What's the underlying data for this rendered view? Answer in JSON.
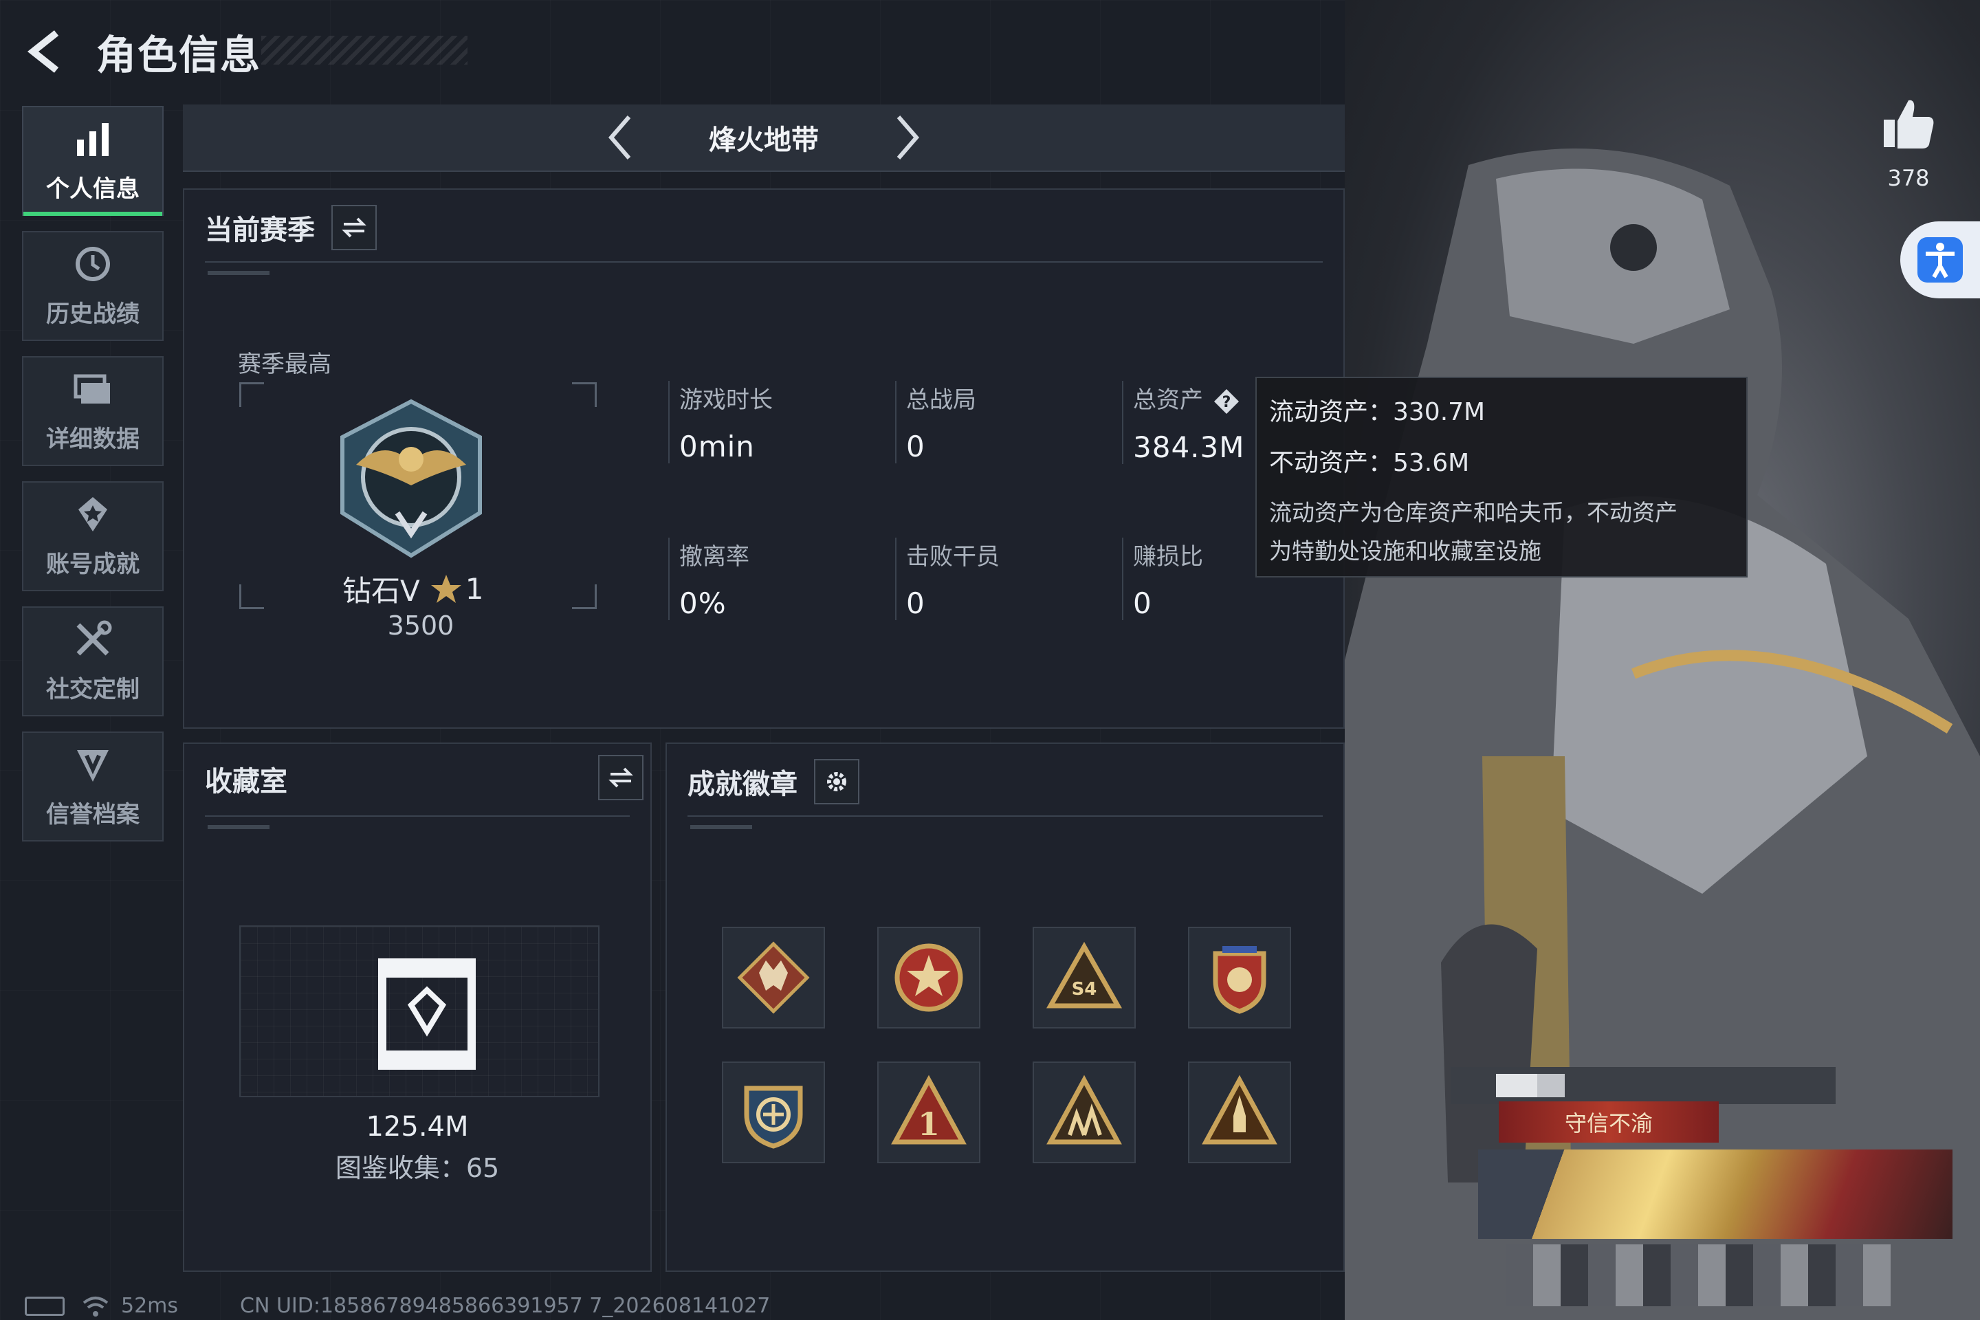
{
  "header": {
    "title": "角色信息"
  },
  "nav": {
    "items": [
      {
        "label": "个人信息",
        "icon": "bar-chart-icon",
        "active": true
      },
      {
        "label": "历史战绩",
        "icon": "history-icon"
      },
      {
        "label": "详细数据",
        "icon": "folder-icon"
      },
      {
        "label": "账号成就",
        "icon": "achievement-icon"
      },
      {
        "label": "社交定制",
        "icon": "tools-icon"
      },
      {
        "label": "信誉档案",
        "icon": "shield-v-icon"
      }
    ]
  },
  "mode": {
    "title": "烽火地带"
  },
  "season": {
    "title": "当前赛季",
    "highest_label": "赛季最高",
    "rank_name": "钻石V",
    "rank_stars": "1",
    "rank_score": "3500",
    "stats": [
      {
        "label": "游戏时长",
        "value": "0min"
      },
      {
        "label": "总战局",
        "value": "0"
      },
      {
        "label": "总资产",
        "value": "384.3M"
      },
      {
        "label": "撤离率",
        "value": "0%"
      },
      {
        "label": "击败干员",
        "value": "0"
      },
      {
        "label": "赚损比",
        "value": "0"
      }
    ]
  },
  "tooltip": {
    "liquid": "流动资产：330.7M",
    "fixed": "不动资产：53.6M",
    "desc_line1": "流动资产为仓库资产和哈夫币，不动资产",
    "desc_line2": "为特勤处设施和收藏室设施"
  },
  "collection": {
    "title": "收藏室",
    "value": "125.4M",
    "count": "图鉴收集：65"
  },
  "achievements": {
    "title": "成就徽章",
    "badges": [
      "wolf-badge-icon",
      "star-medal-icon",
      "s4-triangle-icon",
      "shield-crest-icon",
      "compass-shield-icon",
      "number-one-triangle-icon",
      "soldiers-triangle-icon",
      "rocket-triangle-icon"
    ]
  },
  "profile": {
    "likes": "378",
    "nameplate": "守信不渝"
  },
  "footer": {
    "ping": "52ms",
    "uid": "CN UID:18586789485866391957 7_202608141027"
  },
  "colors": {
    "accent_green": "#3fd27a",
    "gold": "#c9a35a",
    "background": "#1b1f27"
  }
}
